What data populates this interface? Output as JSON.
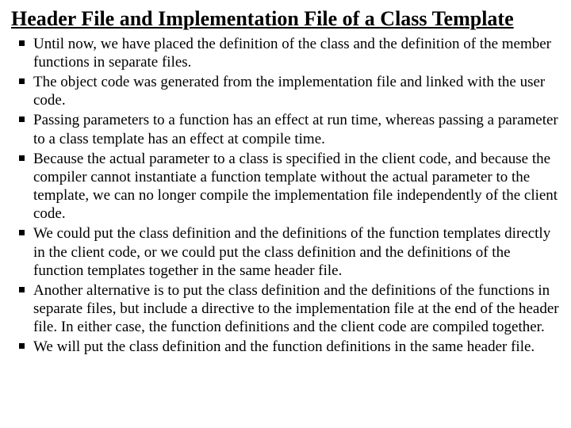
{
  "title": "Header File and Implementation File of a Class Template",
  "bullets": [
    "Until now, we have placed the definition of the class and the definition of the member functions in separate files.",
    "The object code was generated from the implementation file and linked with the user code.",
    "Passing parameters to a function has an effect at run time, whereas passing a parameter to a class template has an effect at compile time.",
    "Because the actual parameter to a class is specified in the client code, and because the compiler cannot instantiate a function template without the actual parameter to the template, we can no longer compile the implementation file independently of the client code.",
    "We could put the class definition and the definitions of the function templates directly in the client code, or we could put the class definition and the definitions of the function templates together in the same header file.",
    "Another alternative is to put the class definition and the definitions of the functions in separate files, but include a directive to the implementation file at the end of the header file. In either case, the function definitions and the client code are compiled together.",
    "We will put the class definition and the function definitions in the same header file."
  ]
}
